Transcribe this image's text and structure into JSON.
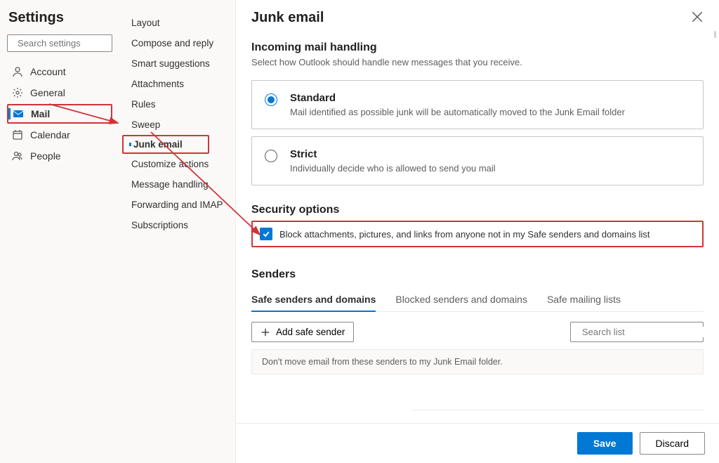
{
  "sidebar": {
    "title": "Settings",
    "search_placeholder": "Search settings",
    "items": [
      {
        "label": "Account"
      },
      {
        "label": "General"
      },
      {
        "label": "Mail"
      },
      {
        "label": "Calendar"
      },
      {
        "label": "People"
      }
    ]
  },
  "subnav": {
    "items": [
      {
        "label": "Layout"
      },
      {
        "label": "Compose and reply"
      },
      {
        "label": "Smart suggestions"
      },
      {
        "label": "Attachments"
      },
      {
        "label": "Rules"
      },
      {
        "label": "Sweep"
      },
      {
        "label": "Junk email"
      },
      {
        "label": "Customize actions"
      },
      {
        "label": "Message handling"
      },
      {
        "label": "Forwarding and IMAP"
      },
      {
        "label": "Subscriptions"
      }
    ]
  },
  "main": {
    "title": "Junk email",
    "incoming": {
      "title": "Incoming mail handling",
      "desc": "Select how Outlook should handle new messages that you receive.",
      "standard": {
        "title": "Standard",
        "desc": "Mail identified as possible junk will be automatically moved to the Junk Email folder"
      },
      "strict": {
        "title": "Strict",
        "desc": "Individually decide who is allowed to send you mail"
      }
    },
    "security": {
      "title": "Security options",
      "block_label": "Block attachments, pictures, and links from anyone not in my Safe senders and domains list"
    },
    "senders": {
      "title": "Senders",
      "tabs": {
        "safe": "Safe senders and domains",
        "blocked": "Blocked senders and domains",
        "lists": "Safe mailing lists"
      },
      "add_btn": "Add safe sender",
      "search_placeholder": "Search list",
      "empty_msg": "Don't move email from these senders to my Junk Email folder."
    }
  },
  "footer": {
    "save": "Save",
    "discard": "Discard"
  }
}
